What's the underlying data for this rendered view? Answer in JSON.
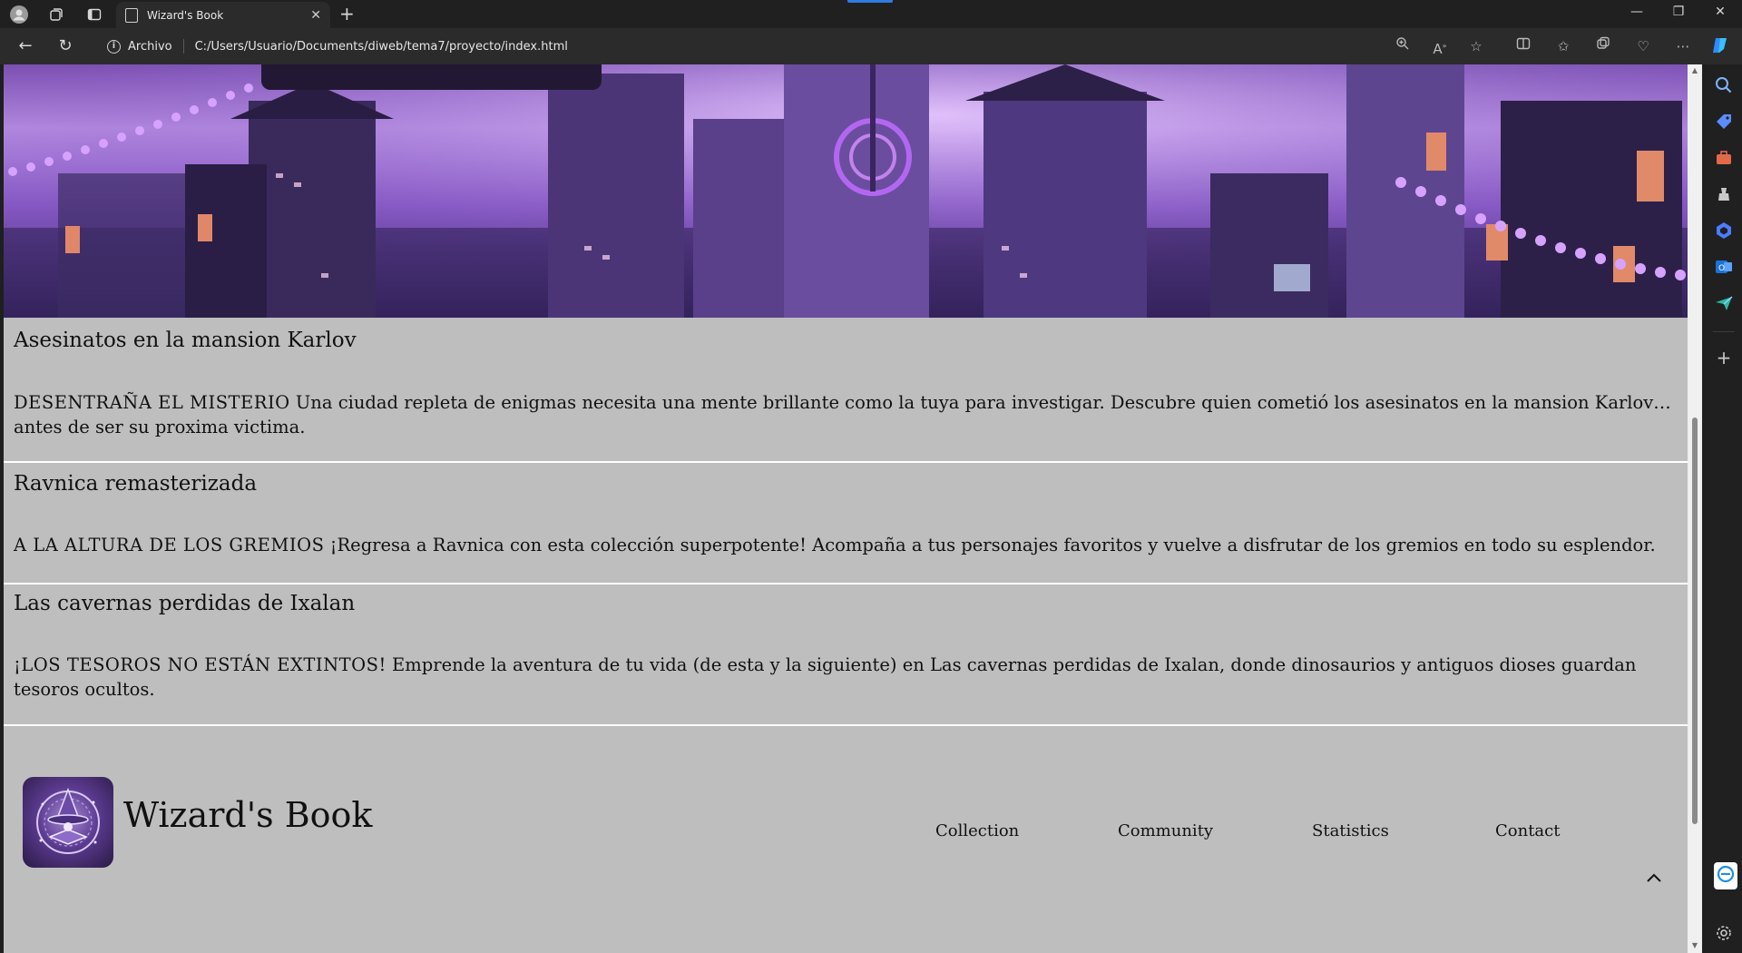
{
  "browser": {
    "tab_title": "Wizard's Book",
    "url_scheme": "Archivo",
    "url": "C:/Users/Usuario/Documents/diweb/tema7/proyecto/index.html"
  },
  "articles": [
    {
      "title": "Asesinatos en la mansion Karlov",
      "caption": "DESENTRAÑA EL MISTERIO",
      "text": " Una ciudad repleta de enigmas necesita una mente brillante como la tuya para investigar. Descubre quien cometió los asesinatos en la mansion Karlov… antes de ser su proxima victima."
    },
    {
      "title": "Ravnica remasterizada",
      "caption": "A LA ALTURA DE LOS GREMIOS",
      "text": " ¡Regresa a Ravnica con esta colección superpotente! Acompaña a tus personajes favoritos y vuelve a disfrutar de los gremios en todo su esplendor."
    },
    {
      "title": "Las cavernas perdidas de Ixalan",
      "caption": "¡LOS TESOROS NO ESTÁN EXTINTOS!",
      "text": " Emprende la aventura de tu vida (de esta y la siguiente) en Las cavernas perdidas de Ixalan, donde dinosaurios y antiguos dioses guardan tesoros ocultos."
    }
  ],
  "footer": {
    "brand": "Wizard's Book",
    "nav": [
      "Collection",
      "Community",
      "Statistics",
      "Contact"
    ]
  },
  "colors": {
    "page_bg": "#bebebe",
    "separator": "#ffffff",
    "chrome_dark": "#202020",
    "chrome_bar": "#2b2b2b"
  },
  "icons": {
    "browser": [
      "profile-icon",
      "workspaces-icon",
      "tab-actions-icon",
      "page-icon",
      "close-icon",
      "plus-icon",
      "back-icon",
      "refresh-icon",
      "info-icon",
      "zoom-icon",
      "read-aloud-icon",
      "star-icon",
      "split-screen-icon",
      "favorites-icon",
      "collections-icon",
      "health-icon",
      "more-icon",
      "copilot-icon"
    ],
    "sidebar": [
      "search-icon",
      "tag-icon",
      "toolbox-icon",
      "chess-icon",
      "m365-icon",
      "outlook-icon",
      "send-icon",
      "add-icon",
      "chat-icon",
      "settings-icon"
    ]
  }
}
